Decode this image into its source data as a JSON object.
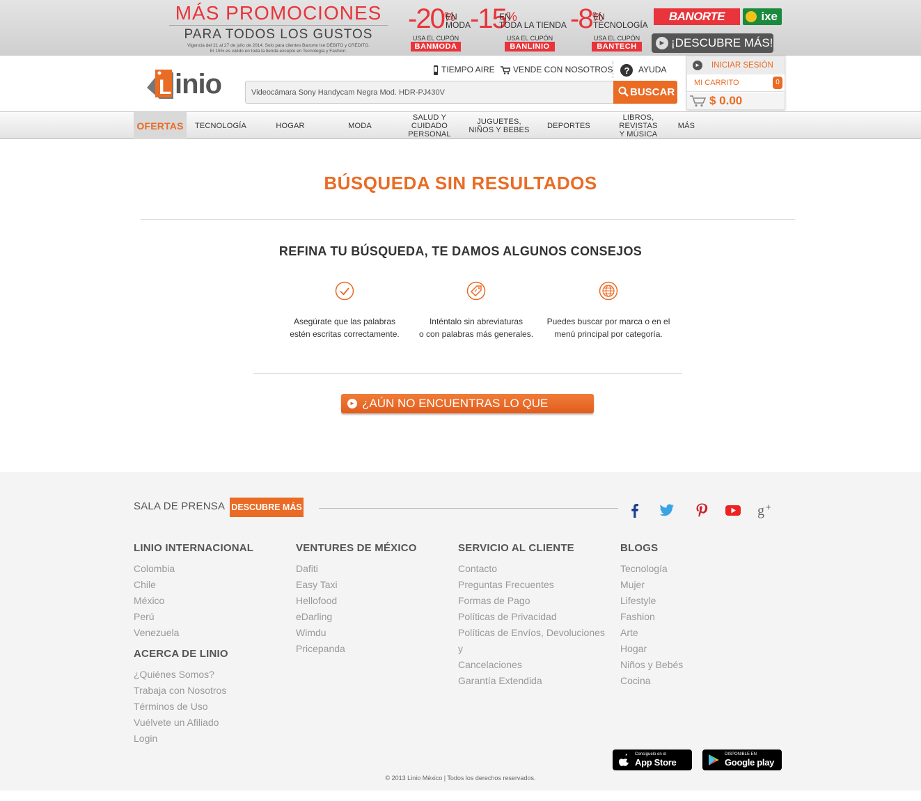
{
  "colors": {
    "brand_orange": "#ea6b24",
    "promo_red": "#e8343a",
    "footer_bg": "#f4f4f4"
  },
  "promo": {
    "title": "MÁS PROMOCIONES",
    "subtitle": "PARA TODOS LOS GUSTOS",
    "fine_print_1": "Vigencia del 21 al 27 de julio de 2014. Solo para clientes Banorte Ixe DÉBITO y CRÉDITO.",
    "fine_print_2": "El 15% es válido en toda la tienda excepto en Tecnología y Fashion.",
    "deals": [
      {
        "pct": "-20",
        "symbol": "%",
        "en": "EN",
        "scope": "MODA",
        "use": "USA EL CUPÓN",
        "code": "BANMODA"
      },
      {
        "pct": "-15",
        "symbol": "%",
        "en": "EN",
        "scope": "TODA LA TIENDA",
        "use": "USA EL CUPÓN",
        "code": "BANLINIO"
      },
      {
        "pct": "-8",
        "symbol": "%",
        "en": "EN",
        "scope": "TECNOLOGÍA",
        "use": "USA EL CUPÓN",
        "code": "BANTECH"
      }
    ],
    "bank1": "BANORTE",
    "bank2": "ixe",
    "discover_label": "¡DESCUBRE MÁS!"
  },
  "header": {
    "logo_text": "inio",
    "logo_letter": "L",
    "util_links": [
      "TIEMPO AIRE",
      "VENDE CON NOSOTROS",
      "AYUDA"
    ],
    "search_value": "Videocámara Sony Handycam Negra Mod. HDR-PJ430V",
    "search_button": "BUSCAR",
    "login_label": "INICIAR SESIÓN",
    "cart_label": "MI CARRITO",
    "cart_count": "0",
    "cart_total": "$ 0.00"
  },
  "nav": [
    "OFERTAS",
    "TECNOLOGÍA",
    "HOGAR",
    "MODA",
    "SALUD Y\nCUIDADO\nPERSONAL",
    "JUGUETES,\nNIÑOS Y BEBES",
    "DEPORTES",
    "LIBROS, REVISTAS\nY MÚSICA",
    "MÁS"
  ],
  "main": {
    "title": "BÚSQUEDA SIN RESULTADOS",
    "tips_title": "REFINA TU BÚSQUEDA, TE DAMOS ALGUNOS CONSEJOS",
    "tips": [
      {
        "icon": "check-icon",
        "text": "Asegúrate que las palabras\nestén escritas correctamente."
      },
      {
        "icon": "tag-icon",
        "text": "Inténtalo sin abreviaturas\no con palabras más generales."
      },
      {
        "icon": "globe-icon",
        "text": "Puedes buscar por marca o en el\nmenú principal por categoría."
      }
    ],
    "not_found_button": "¿AÚN NO ENCUENTRAS LO QUE BUSCAS?"
  },
  "footer": {
    "press_label": "SALA DE PRENSA",
    "press_button": "DESCUBRE MÁS",
    "social": [
      "facebook-icon",
      "twitter-icon",
      "pinterest-icon",
      "youtube-icon",
      "google-plus-icon"
    ],
    "columns": [
      {
        "heading": "LINIO INTERNACIONAL",
        "links": [
          "Colombia",
          "Chile",
          "México",
          "Perú",
          "Venezuela"
        ],
        "heading2": "ACERCA DE LINIO",
        "links2": [
          "¿Quiénes Somos?",
          "Trabaja con Nosotros",
          "Términos de Uso",
          "Vuélvete un Afiliado",
          "Login"
        ]
      },
      {
        "heading": "VENTURES DE MÉXICO",
        "links": [
          "Dafiti",
          "Easy Taxi",
          "Hellofood",
          "eDarling",
          "Wimdu",
          "Pricepanda"
        ]
      },
      {
        "heading": "SERVICIO AL CLIENTE",
        "links": [
          "Contacto",
          "Preguntas Frecuentes",
          "Formas de Pago",
          "Políticas de Privacidad",
          "Políticas de Envíos, Devoluciones y",
          "Cancelaciones",
          "Garantía Extendida"
        ]
      },
      {
        "heading": "BLOGS",
        "links": [
          "Tecnología",
          "Mujer",
          "Lifestyle",
          "Fashion",
          "Arte",
          "Hogar",
          "Niños y Bebés",
          "Cocina"
        ]
      }
    ],
    "appstore_small": "Consíguelo en el",
    "appstore_big": "App Store",
    "googleplay_small": "DISPONIBLE EN",
    "googleplay_big": "Google play",
    "copyright": "© 2013 Linio México | Todos los derechos reservados."
  }
}
